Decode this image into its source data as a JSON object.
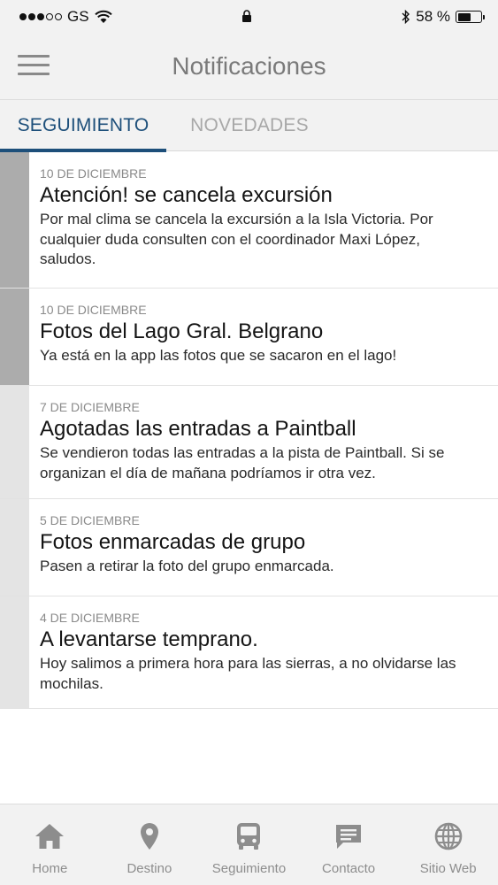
{
  "status_bar": {
    "carrier": "GS",
    "battery": "58 %"
  },
  "header": {
    "title": "Notificaciones",
    "menu_icon": "hamburger-icon"
  },
  "tabs": [
    {
      "label": "SEGUIMIENTO",
      "active": true
    },
    {
      "label": "NOVEDADES",
      "active": false
    }
  ],
  "notifications": [
    {
      "date": "10 DE DICIEMBRE",
      "title": "Atención! se cancela excursión",
      "body": "Por mal clima se cancela la excursión a la Isla Victoria. Por cualquier duda consulten con el coordinador Maxi López, saludos.",
      "unread": true
    },
    {
      "date": "10 DE DICIEMBRE",
      "title": "Fotos del Lago Gral. Belgrano",
      "body": "Ya está en la app las fotos que se sacaron en el lago!",
      "unread": true
    },
    {
      "date": "7 DE DICIEMBRE",
      "title": "Agotadas las entradas a Paintball",
      "body": "Se vendieron todas las entradas a la pista de Paintball. Si se organizan el día de mañana podríamos ir otra vez.",
      "unread": false
    },
    {
      "date": "5 DE DICIEMBRE",
      "title": "Fotos enmarcadas de grupo",
      "body": "Pasen a retirar la foto del grupo enmarcada.",
      "unread": false
    },
    {
      "date": "4 DE DICIEMBRE",
      "title": "A levantarse temprano.",
      "body": "Hoy salimos a primera hora para las sierras, a no olvidarse las mochilas.",
      "unread": false
    }
  ],
  "bottom_nav": [
    {
      "label": "Home",
      "icon": "home-icon"
    },
    {
      "label": "Destino",
      "icon": "location-pin-icon"
    },
    {
      "label": "Seguimiento",
      "icon": "bus-icon"
    },
    {
      "label": "Contacto",
      "icon": "chat-bubble-icon"
    },
    {
      "label": "Sitio Web",
      "icon": "globe-icon"
    }
  ],
  "colors": {
    "accent": "#1d4f7a",
    "inactive": "#8d8d8d",
    "unread_bar": "#acacac",
    "read_bar": "#e4e4e4"
  }
}
